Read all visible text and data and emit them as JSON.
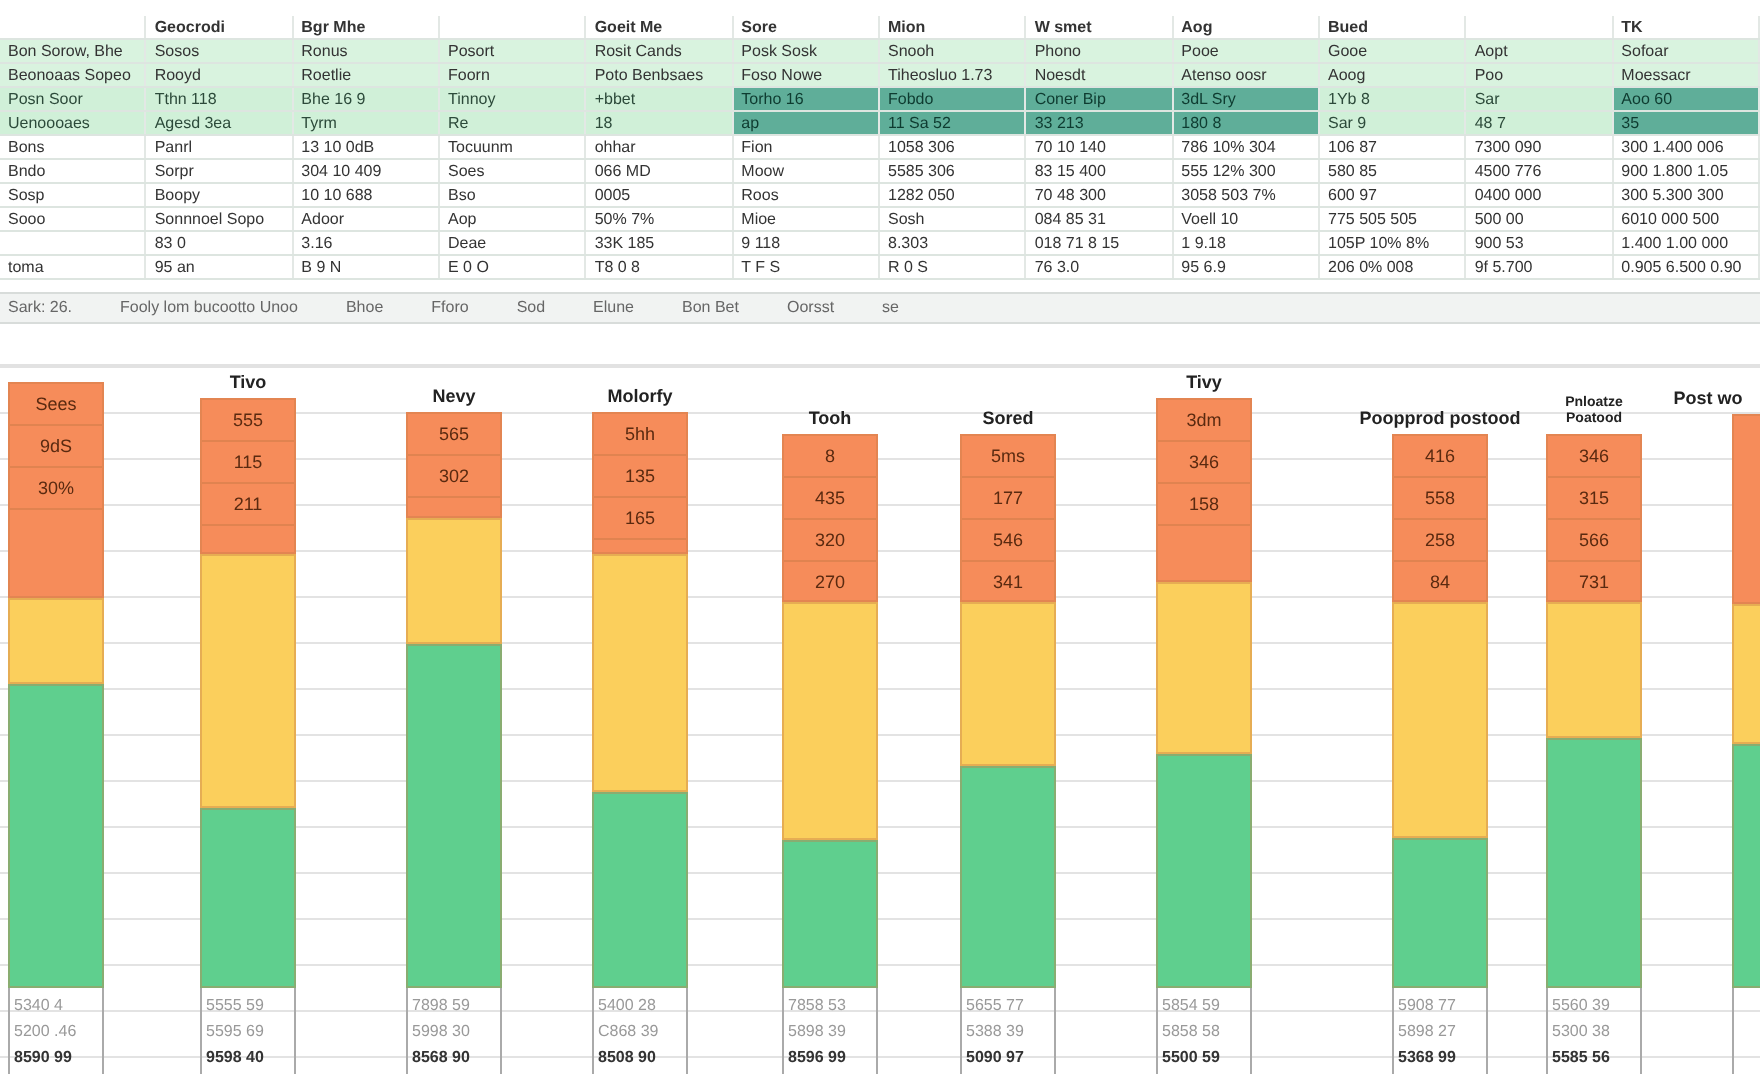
{
  "sheet": {
    "rows": [
      {
        "kind": "header",
        "cells": [
          null,
          "Geocrodi",
          "Bgr Mhe",
          null,
          "Goeit Me",
          "Sore",
          "Mion",
          "W smet",
          "Aog",
          "Bued",
          null,
          "TK"
        ]
      },
      {
        "kind": "band",
        "cells": [
          "Bon Sorow, Bhe",
          "Sosos",
          "Ronus",
          "Posort",
          "Rosit Cands",
          "Posk Sosk",
          "Snooh",
          "Phono",
          "Pooe",
          "Gooe",
          "Aopt",
          "Sofoar"
        ]
      },
      {
        "kind": "band",
        "cells": [
          "Beonoaas Sopeo",
          "Rooyd",
          "Roetlie",
          "Foorn",
          "Poto Benbsaes",
          "Foso Nowe",
          "Tiheosluo 1.73",
          "Noesdt",
          "Atenso oosr",
          "Aoog",
          "Poo",
          "Moessacr"
        ]
      },
      {
        "kind": "accent",
        "cells": [
          {
            "text": "Posn Soor",
            "selected": false
          },
          {
            "text": "Tthn 118",
            "selected": false
          },
          {
            "text": "Bhe 16 9",
            "selected": false
          },
          {
            "text": "Tinnoy",
            "selected": false
          },
          {
            "text": "+bbet",
            "selected": false
          },
          {
            "text": "Torho 16",
            "selected": true
          },
          {
            "text": "Fobdo",
            "selected": true
          },
          {
            "text": "Coner Bip",
            "selected": true
          },
          {
            "text": "3dL Sry",
            "selected": true
          },
          {
            "text": "1Yb 8",
            "selected": false
          },
          {
            "text": "Sar",
            "selected": false
          },
          {
            "text": "Aoo 60",
            "selected": true
          }
        ]
      },
      {
        "kind": "accent",
        "cells": [
          {
            "text": "Uenoooaes",
            "selected": false
          },
          {
            "text": "Agesd 3ea",
            "selected": false
          },
          {
            "text": "Tyrm",
            "selected": false
          },
          {
            "text": "Re",
            "selected": false
          },
          {
            "text": "18",
            "selected": false
          },
          {
            "text": "ap",
            "selected": true
          },
          {
            "text": "11 Sa 52",
            "selected": true
          },
          {
            "text": "33 213",
            "selected": true
          },
          {
            "text": "180 8",
            "selected": true
          },
          {
            "text": "Sar 9",
            "selected": false
          },
          {
            "text": "48 7",
            "selected": false
          },
          {
            "text": "35",
            "selected": true
          }
        ]
      },
      {
        "kind": "plain",
        "cells": [
          "Bons",
          "Panrl",
          "13 10 0dB",
          "Tocuunm",
          "ohhar",
          "Fion",
          "1058 306",
          "70 10 140",
          "786 10% 304",
          "106 87",
          "7300 090",
          "300 1.400 006"
        ]
      },
      {
        "kind": "plain",
        "cells": [
          "Bndo",
          "Sorpr",
          "304 10 409",
          "Soes",
          "066 MD",
          "Moow",
          "5585 306",
          "83 15 400",
          "555 12% 300",
          "580 85",
          "4500 776",
          "900 1.800 1.05"
        ]
      },
      {
        "kind": "plain",
        "cells": [
          "Sosp",
          "Boopy",
          "10 10 688",
          "Bso",
          "0005",
          "Roos",
          "1282 050",
          "70 48 300",
          "3058 503 7%",
          "600 97",
          "0400 000",
          "300 5.300 300"
        ]
      },
      {
        "kind": "plain",
        "cells": [
          "Sooo",
          "Sonnnoel Sopo",
          "Adoor",
          "Aop",
          "50% 7%",
          "Mioe",
          "Sosh",
          "084 85 31",
          "Voell 10",
          "775 505 505",
          "500 00",
          "6010 000 500"
        ]
      },
      {
        "kind": "plain",
        "cells": [
          null,
          "83 0",
          "3.16",
          "Deae",
          "33K 185",
          "9 118",
          "8.303",
          "018 71 8 15",
          "1 9.18",
          "105P 10% 8%",
          "900 53",
          "1.400 1.00 000"
        ]
      },
      {
        "kind": "plain",
        "cells": [
          "toma",
          "95 an",
          "B 9 N",
          "E 0 O",
          "T8 0 8",
          "T F S",
          "R 0 S",
          "76 3.0",
          "95 6.9",
          "206 0% 008",
          "9f 5.700",
          "0.905 6.500 0.90"
        ]
      }
    ],
    "toolbar": [
      "Sark: 26.",
      "Fooly lom bucootto Unoo",
      "Bhoe",
      "Fforo",
      "Sod",
      "Elune",
      "Bon Bet",
      "Oorsst",
      "se"
    ]
  },
  "columns": [
    {
      "segments": [
        {
          "color": "#f68c5a",
          "labels": [
            "Sees",
            "9dS",
            "30%"
          ]
        },
        {
          "color": "#fbcf5c"
        },
        {
          "color": "#5fcf8e"
        }
      ],
      "footer": [
        "5340 4",
        "5200 .46",
        "8590 99"
      ]
    },
    {
      "label": "Tivo",
      "segments": [
        {
          "color": "#f68c5a",
          "labels": [
            "555",
            "115",
            "211"
          ]
        },
        {
          "color": "#fbcf5c"
        },
        {
          "color": "#5fcf8e"
        }
      ],
      "footer": [
        "5555 59",
        "5595 69",
        "9598 40"
      ]
    },
    {
      "label": "Nevy",
      "segments": [
        {
          "color": "#f68c5a",
          "labels": [
            "565",
            "302"
          ]
        },
        {
          "color": "#fbcf5c"
        },
        {
          "color": "#5fcf8e"
        }
      ],
      "footer": [
        "7898 59",
        "5998 30",
        "8568 90"
      ]
    },
    {
      "label": "Molorfy",
      "segments": [
        {
          "color": "#f68c5a",
          "labels": [
            "5hh",
            "135",
            "165"
          ]
        },
        {
          "color": "#fbcf5c"
        },
        {
          "color": "#5fcf8e"
        }
      ],
      "footer": [
        "5400 28",
        "C868 39",
        "8508 90"
      ]
    },
    {
      "label": "Tooh",
      "segments": [
        {
          "color": "#f68c5a",
          "labels": [
            "8",
            "435",
            "320",
            "270"
          ]
        },
        {
          "color": "#fbcf5c"
        },
        {
          "color": "#5fcf8e"
        }
      ],
      "footer": [
        "7858 53",
        "5898 39",
        "8596 99"
      ]
    },
    {
      "label": "Sored",
      "segments": [
        {
          "color": "#f68c5a",
          "labels": [
            "5ms",
            "177",
            "546",
            "341"
          ]
        },
        {
          "color": "#fbcf5c"
        },
        {
          "color": "#5fcf8e"
        }
      ],
      "footer": [
        "5655 77",
        "5388 39",
        "5090 97"
      ]
    },
    {
      "label": "Tivy",
      "segments": [
        {
          "color": "#f68c5a",
          "labels": [
            "3dm",
            "346",
            "158"
          ]
        },
        {
          "color": "#fbcf5c"
        },
        {
          "color": "#5fcf8e"
        }
      ],
      "footer": [
        "5854 59",
        "5858 58",
        "5500 59"
      ]
    },
    {
      "label": "Poopprod postood",
      "segments": [
        {
          "color": "#f68c5a",
          "labels": [
            "416",
            "558",
            "258",
            "84"
          ]
        },
        {
          "color": "#fbcf5c"
        },
        {
          "color": "#5fcf8e"
        }
      ],
      "footer": [
        "5908 77",
        "5898 27",
        "5368 99"
      ]
    },
    {
      "label": "Pnloatze Poatood",
      "segments": [
        {
          "color": "#f68c5a",
          "labels": [
            "346",
            "315",
            "566",
            "731"
          ]
        },
        {
          "color": "#fbcf5c"
        },
        {
          "color": "#5fcf8e"
        }
      ],
      "footer": [
        "5560 39",
        "5300 38",
        "5585 56"
      ]
    },
    {
      "label": "Post wo",
      "segments": [
        {
          "color": "#f68c5a"
        },
        {
          "color": "#fbcf5c"
        },
        {
          "color": "#5fcf8e"
        }
      ]
    }
  ]
}
